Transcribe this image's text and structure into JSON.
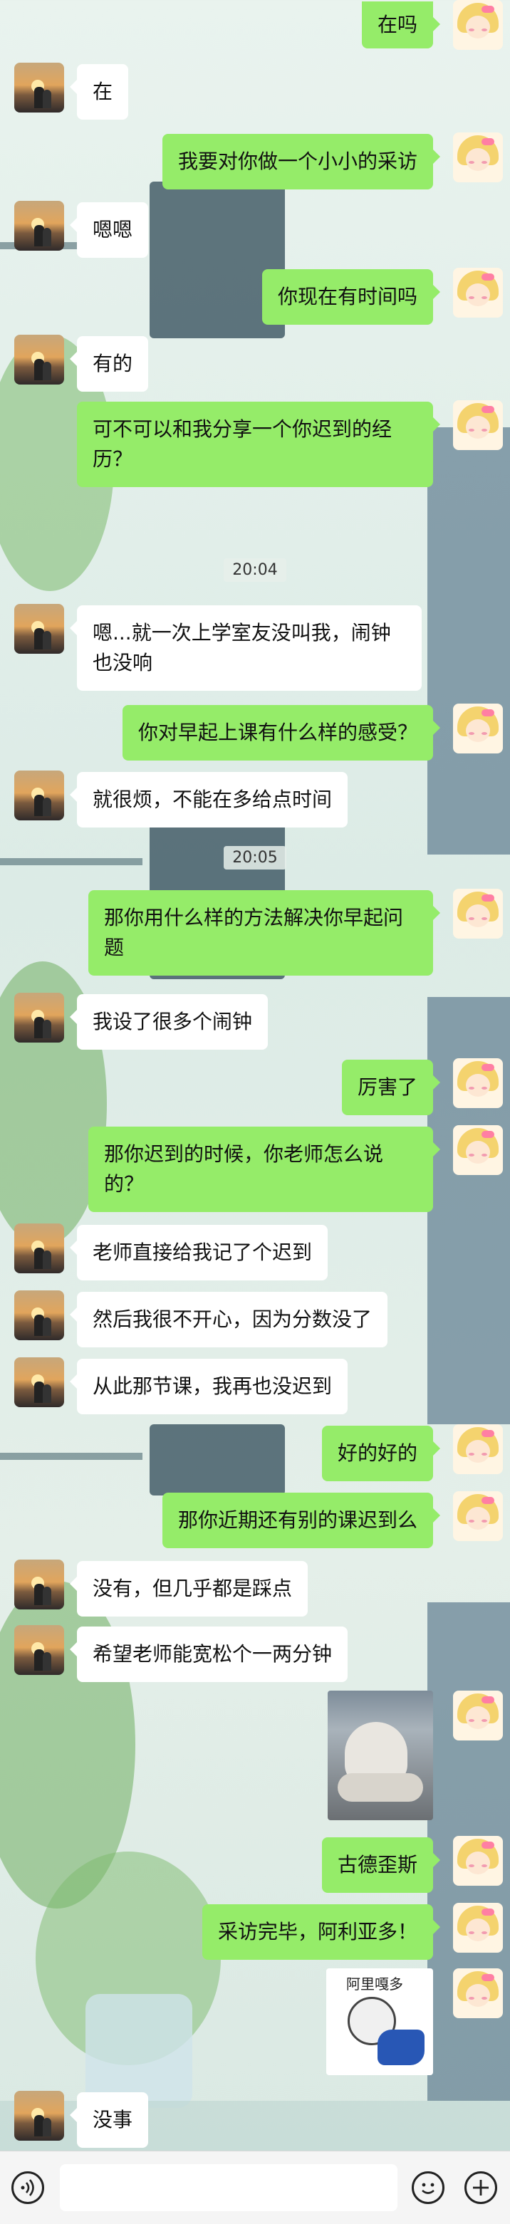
{
  "chat": {
    "messages": [
      {
        "side": "right",
        "text": "在吗"
      },
      {
        "side": "left",
        "text": "在"
      },
      {
        "side": "right",
        "text": "我要对你做一个小小的采访"
      },
      {
        "side": "left",
        "text": "嗯嗯"
      },
      {
        "side": "right",
        "text": "你现在有时间吗"
      },
      {
        "side": "left",
        "text": "有的"
      },
      {
        "side": "right",
        "text": "可不可以和我分享一个你迟到的经历？"
      },
      {
        "time": "20:04"
      },
      {
        "side": "left",
        "text": "嗯...就一次上学室友没叫我，闹钟也没响"
      },
      {
        "side": "right",
        "text": "你对早起上课有什么样的感受？"
      },
      {
        "side": "left",
        "text": "就很烦，不能在多给点时间"
      },
      {
        "time": "20:05"
      },
      {
        "side": "right",
        "text": "那你用什么样的方法解决你早起问题"
      },
      {
        "side": "left",
        "text": "我设了很多个闹钟"
      },
      {
        "side": "right",
        "text": "厉害了"
      },
      {
        "side": "right",
        "text": "那你迟到的时候，你老师怎么说的？"
      },
      {
        "side": "left",
        "text": "老师直接给我记了个迟到"
      },
      {
        "side": "left",
        "text": "然后我很不开心，因为分数没了"
      },
      {
        "side": "left",
        "text": "从此那节课，我再也没迟到"
      },
      {
        "side": "right",
        "text": "好的好的"
      },
      {
        "side": "right",
        "text": "那你近期还有别的课迟到么"
      },
      {
        "side": "left",
        "text": "没有，但几乎都是踩点"
      },
      {
        "side": "left",
        "text": "希望老师能宽松个一两分钟"
      },
      {
        "side": "right",
        "image": "photo-hat"
      },
      {
        "side": "right",
        "text": "古德歪斯"
      },
      {
        "side": "right",
        "text": "采访完毕，阿利亚多！"
      },
      {
        "side": "right",
        "image": "sticker",
        "sticker_text": "阿里嘎多"
      },
      {
        "side": "left",
        "text": "没事"
      }
    ]
  },
  "input_bar": {
    "voice_icon": "voice-icon",
    "emoji_icon": "emoji-icon",
    "plus_icon": "plus-icon",
    "placeholder": ""
  },
  "colors": {
    "self_bubble": "#95ec69",
    "other_bubble": "#ffffff"
  }
}
